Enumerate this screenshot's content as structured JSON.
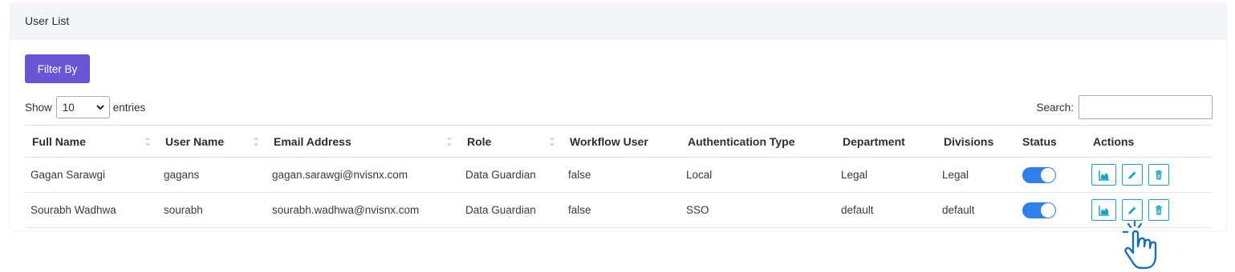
{
  "card": {
    "title": "User List"
  },
  "filter": {
    "label": "Filter By"
  },
  "length": {
    "show_label": "Show",
    "selected": "10",
    "entries_label": "entries"
  },
  "search": {
    "label": "Search:",
    "value": ""
  },
  "table": {
    "columns": [
      "Full Name",
      "User Name",
      "Email Address",
      "Role",
      "Workflow User",
      "Authentication Type",
      "Department",
      "Divisions",
      "Status",
      "Actions"
    ],
    "rows": [
      {
        "full_name": "Gagan Sarawgi",
        "user_name": "gagans",
        "email": "gagan.sarawgi@nvisnx.com",
        "role": "Data Guardian",
        "workflow_user": "false",
        "auth_type": "Local",
        "department": "Legal",
        "divisions": "Legal",
        "status": "on"
      },
      {
        "full_name": "Sourabh Wadhwa",
        "user_name": "sourabh",
        "email": "sourabh.wadhwa@nvisnx.com",
        "role": "Data Guardian",
        "workflow_user": "false",
        "auth_type": "SSO",
        "department": "default",
        "divisions": "default",
        "status": "on"
      }
    ]
  },
  "icons": {
    "chart": "chart-area-icon",
    "edit": "pencil-icon",
    "delete": "trash-icon",
    "cursor": "hand-pointer-icon"
  },
  "colors": {
    "primary": "#6a55d6",
    "toggle": "#2f80ed",
    "action_border": "#1aa3c9"
  }
}
